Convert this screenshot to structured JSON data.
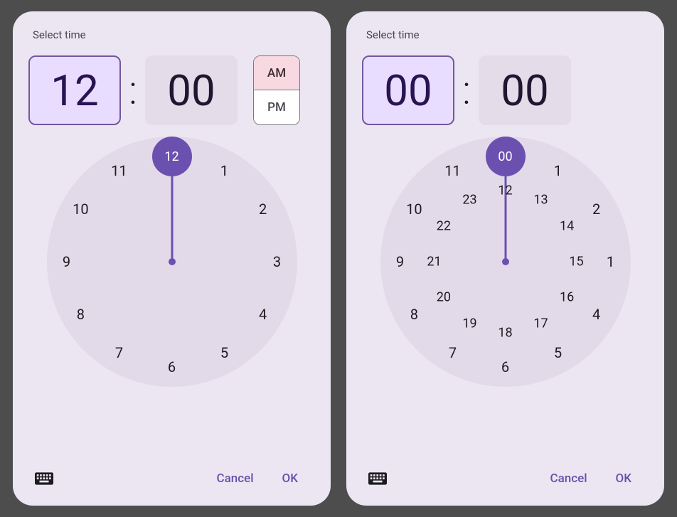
{
  "left": {
    "is24h": false,
    "title": "Select time",
    "hour_display": "12",
    "minute_display": "00",
    "selected_field": "hour",
    "am_label": "AM",
    "pm_label": "PM",
    "period_selected": "AM",
    "outer_ticks": [
      "12",
      "1",
      "2",
      "3",
      "4",
      "5",
      "6",
      "7",
      "8",
      "9",
      "10",
      "11"
    ],
    "selected_tick_index": 0,
    "inner_ticks": null,
    "thumb_label": "12",
    "cancel_label": "Cancel",
    "ok_label": "OK"
  },
  "right": {
    "is24h": true,
    "title": "Select time",
    "hour_display": "00",
    "minute_display": "00",
    "selected_field": "hour",
    "am_label": null,
    "pm_label": null,
    "period_selected": null,
    "outer_ticks": [
      "00",
      "1",
      "2",
      "1",
      "4",
      "5",
      "6",
      "7",
      "8",
      "9",
      "10",
      "11"
    ],
    "selected_tick_index": 0,
    "inner_ticks": [
      "12",
      "13",
      "14",
      "15",
      "16",
      "17",
      "18",
      "19",
      "20",
      "21",
      "22",
      "23"
    ],
    "thumb_label": "00",
    "cancel_label": "Cancel",
    "ok_label": "OK"
  },
  "dial": {
    "size": 352,
    "outer_radius": 148,
    "inner_radius": 100,
    "hand_len_outer": 120
  }
}
